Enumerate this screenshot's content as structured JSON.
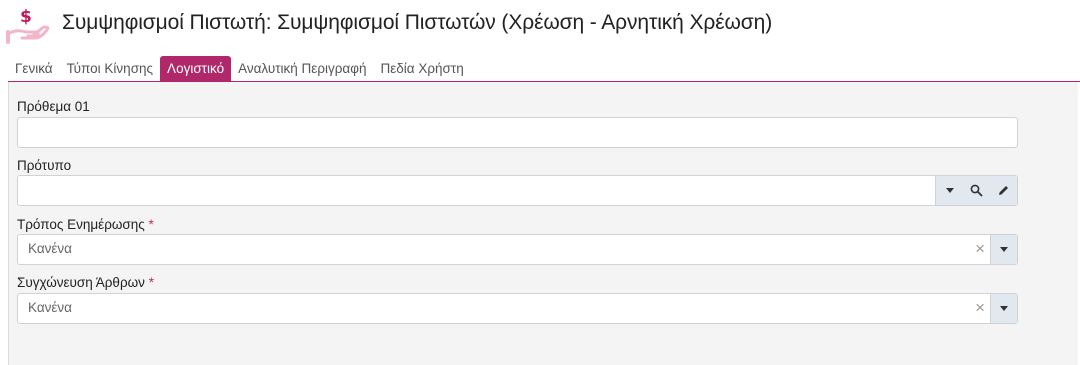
{
  "header": {
    "title": "Συμψηφισμοί Πιστωτή: Συμψηφισμοί Πιστωτών (Χρέωση - Αρνητική Χρέωση)",
    "logo_icon": "money-hand-icon",
    "logo_symbol": "$"
  },
  "tabs": [
    {
      "label": "Γενικά"
    },
    {
      "label": "Τύποι Κίνησης"
    },
    {
      "label": "Λογιστικό"
    },
    {
      "label": "Αναλυτική Περιγραφή"
    },
    {
      "label": "Πεδία Χρήστη"
    }
  ],
  "active_tab": "Λογιστικό",
  "colors": {
    "accent": "#b0286a",
    "panel_bg": "#f4f4f4",
    "button_bg": "#e2e8ef"
  },
  "form": {
    "prefix": {
      "label": "Πρόθεμα 01",
      "value": ""
    },
    "template": {
      "label": "Πρότυπο",
      "value": "",
      "icons": [
        "chevron-down-icon",
        "search-icon",
        "pencil-icon"
      ]
    },
    "update_mode": {
      "label": "Τρόπος Ενημέρωσης",
      "required_mark": "*",
      "value": "Κανένα"
    },
    "merge_entries": {
      "label": "Συγχώνευση Άρθρων",
      "required_mark": "*",
      "value": "Κανένα"
    }
  }
}
